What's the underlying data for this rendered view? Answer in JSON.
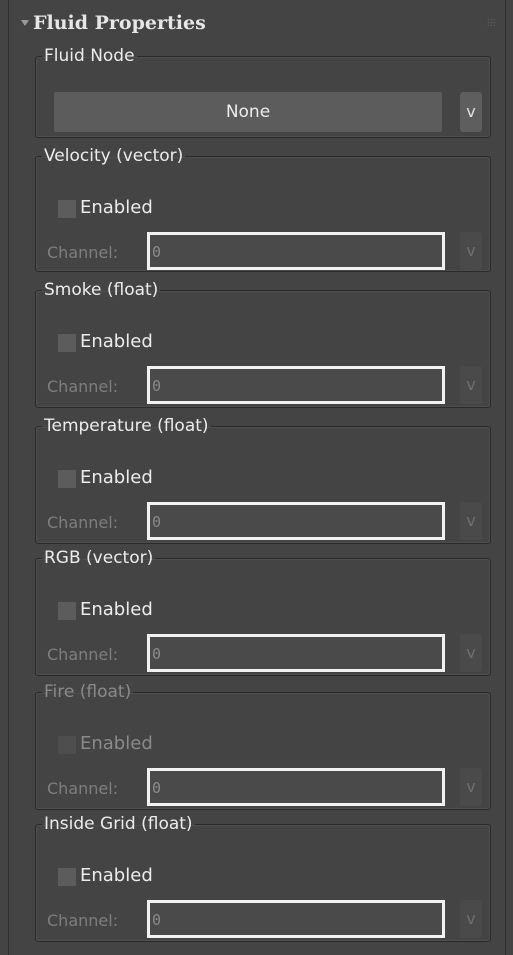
{
  "rollout": {
    "title": "Fluid Properties"
  },
  "fluid_node": {
    "legend": "Fluid Node",
    "button_label": "None",
    "v_label": "v"
  },
  "channels": [
    {
      "legend": "Velocity (vector)",
      "enabled_label": "Enabled",
      "enabled": false,
      "disabled": false,
      "channel_label": "Channel:",
      "value": "0",
      "v_label": "v"
    },
    {
      "legend": "Smoke (float)",
      "enabled_label": "Enabled",
      "enabled": false,
      "disabled": false,
      "channel_label": "Channel:",
      "value": "0",
      "v_label": "v"
    },
    {
      "legend": "Temperature (float)",
      "enabled_label": "Enabled",
      "enabled": false,
      "disabled": false,
      "channel_label": "Channel:",
      "value": "0",
      "v_label": "v"
    },
    {
      "legend": "RGB (vector)",
      "enabled_label": "Enabled",
      "enabled": false,
      "disabled": false,
      "channel_label": "Channel:",
      "value": "0",
      "v_label": "v"
    },
    {
      "legend": "Fire (float)",
      "enabled_label": "Enabled",
      "enabled": false,
      "disabled": true,
      "channel_label": "Channel:",
      "value": "0",
      "v_label": "v"
    },
    {
      "legend": "Inside Grid (float)",
      "enabled_label": "Enabled",
      "enabled": false,
      "disabled": false,
      "channel_label": "Channel:",
      "value": "0",
      "v_label": "v"
    }
  ],
  "colors": {
    "background": "#444444",
    "input_border": "#f2f2f2",
    "button": "#5c5c5c",
    "text": "#ececec",
    "dim_text": "#7e7e7e"
  }
}
